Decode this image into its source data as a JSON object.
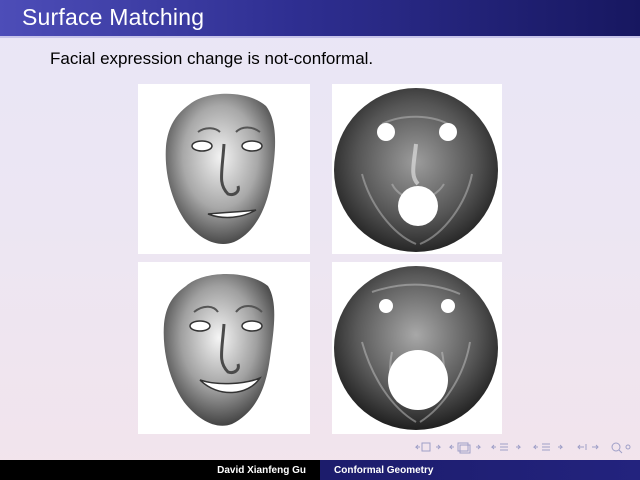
{
  "slide": {
    "title": "Surface Matching",
    "subtitle": "Facial expression change is not-conformal."
  },
  "footer": {
    "author": "David Xianfeng Gu",
    "course": "Conformal Geometry"
  },
  "figures": [
    {
      "row": 1,
      "kind": "3d-face-mesh",
      "expression": "neutral-smile"
    },
    {
      "row": 1,
      "kind": "conformal-disk-map"
    },
    {
      "row": 2,
      "kind": "3d-face-mesh",
      "expression": "big-smile"
    },
    {
      "row": 2,
      "kind": "conformal-disk-map"
    }
  ],
  "colors": {
    "title_bar": "#2f2f92",
    "footer_left": "#000000",
    "footer_right": "#1c1c6c"
  }
}
